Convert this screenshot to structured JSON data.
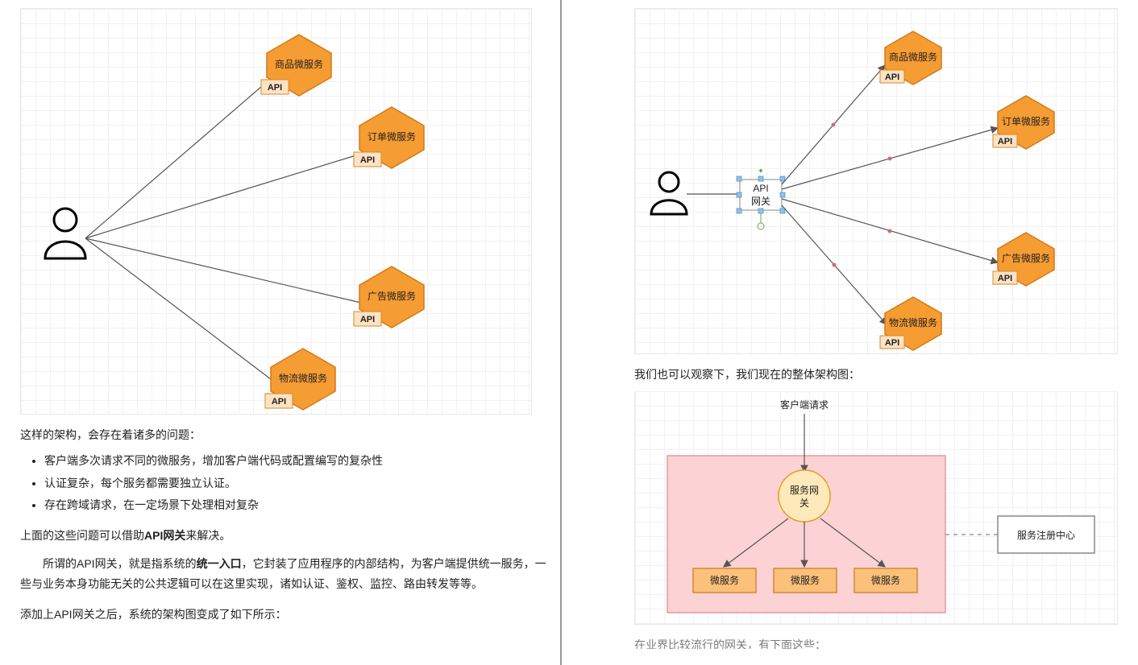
{
  "left": {
    "services": [
      {
        "label": "商品微服务",
        "api": "API"
      },
      {
        "label": "订单微服务",
        "api": "API"
      },
      {
        "label": "广告微服务",
        "api": "API"
      },
      {
        "label": "物流微服务",
        "api": "API"
      }
    ],
    "problems_intro": "这样的架构，会存在着诸多的问题：",
    "problems": [
      "客户端多次请求不同的微服务，增加客户端代码或配置编写的复杂性",
      "认证复杂，每个服务都需要独立认证。",
      "存在跨域请求，在一定场景下处理相对复杂"
    ],
    "solution_pre": "上面的这些问题可以借助",
    "solution_bold": "API网关",
    "solution_post": "来解决。",
    "gateway_para_pre": "所谓的API网关，就是指系统的",
    "gateway_bold": "统一入口",
    "gateway_para_post": "，它封装了应用程序的内部结构，为客户端提供统一服务，一些与业务本身功能无关的公共逻辑可以在这里实现，诸如认证、鉴权、监控、路由转发等等。",
    "after_add": "添加上API网关之后，系统的架构图变成了如下所示："
  },
  "right": {
    "services": [
      {
        "label": "商品微服务",
        "api": "API"
      },
      {
        "label": "订单微服务",
        "api": "API"
      },
      {
        "label": "广告微服务",
        "api": "API"
      },
      {
        "label": "物流微服务",
        "api": "API"
      }
    ],
    "gateway_label_l1": "API",
    "gateway_label_l2": "网关",
    "observe_text": "我们也可以观察下，我们现在的整体架构图：",
    "arch": {
      "client_req": "客户端请求",
      "gateway": "服务网关",
      "ms": "微服务",
      "registry": "服务注册中心"
    },
    "bottom_cut": "在业界比较流行的网关，有下面这些："
  }
}
